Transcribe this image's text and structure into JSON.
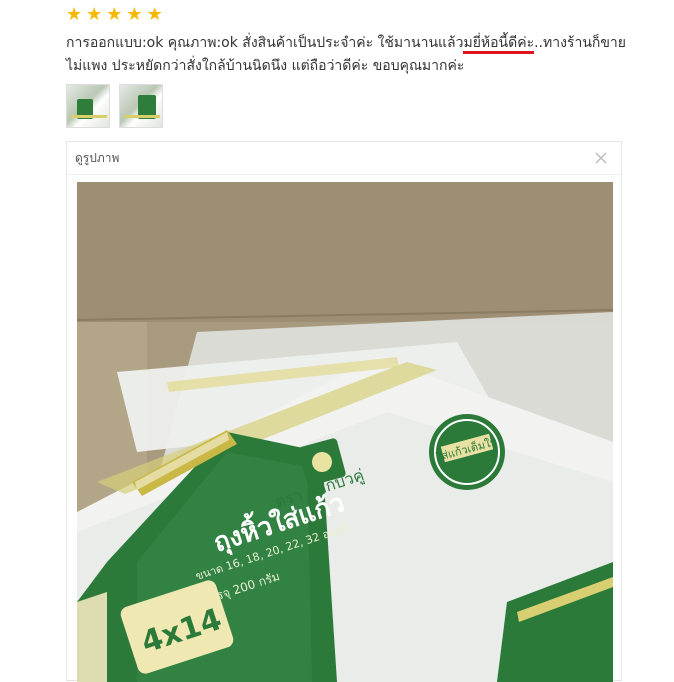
{
  "review": {
    "rating": 5,
    "text_before": "การออกแบบ:ok คุณภาพ:ok สั่งสินค้าเป็นประจำค่ะ ใช้มานานแล้ว",
    "text_highlight": "มยี่ห้อนี้ดีค่ะ",
    "text_after": "..ทางร้านก็ขายไม่แพง ประหยัดกว่าสั่งใกล้บ้านนิดนึง แต่ถือว่าดีค่ะ ขอบคุณมากค่ะ",
    "highlight_color": "#e0141e",
    "star_color": "#f6b800",
    "thumbnails": [
      "thumbnail-1",
      "thumbnail-2"
    ]
  },
  "viewer": {
    "title": "ดูรูปภาพ",
    "close_icon": "close-icon"
  },
  "photo": {
    "package_brand": "ตรา ดอกบัวคู่",
    "package_title": "ถุงหิ้วใส่แก้ว",
    "package_sizes": "ขนาด 16, 18, 20, 22, 32 ออนซ์",
    "package_material": "PE บรรจุ 200 กรัม",
    "package_size_main": "4x14",
    "badge_text": "ใส่แก้วเต็มใบ",
    "brand_green": "#2c7a3a"
  }
}
